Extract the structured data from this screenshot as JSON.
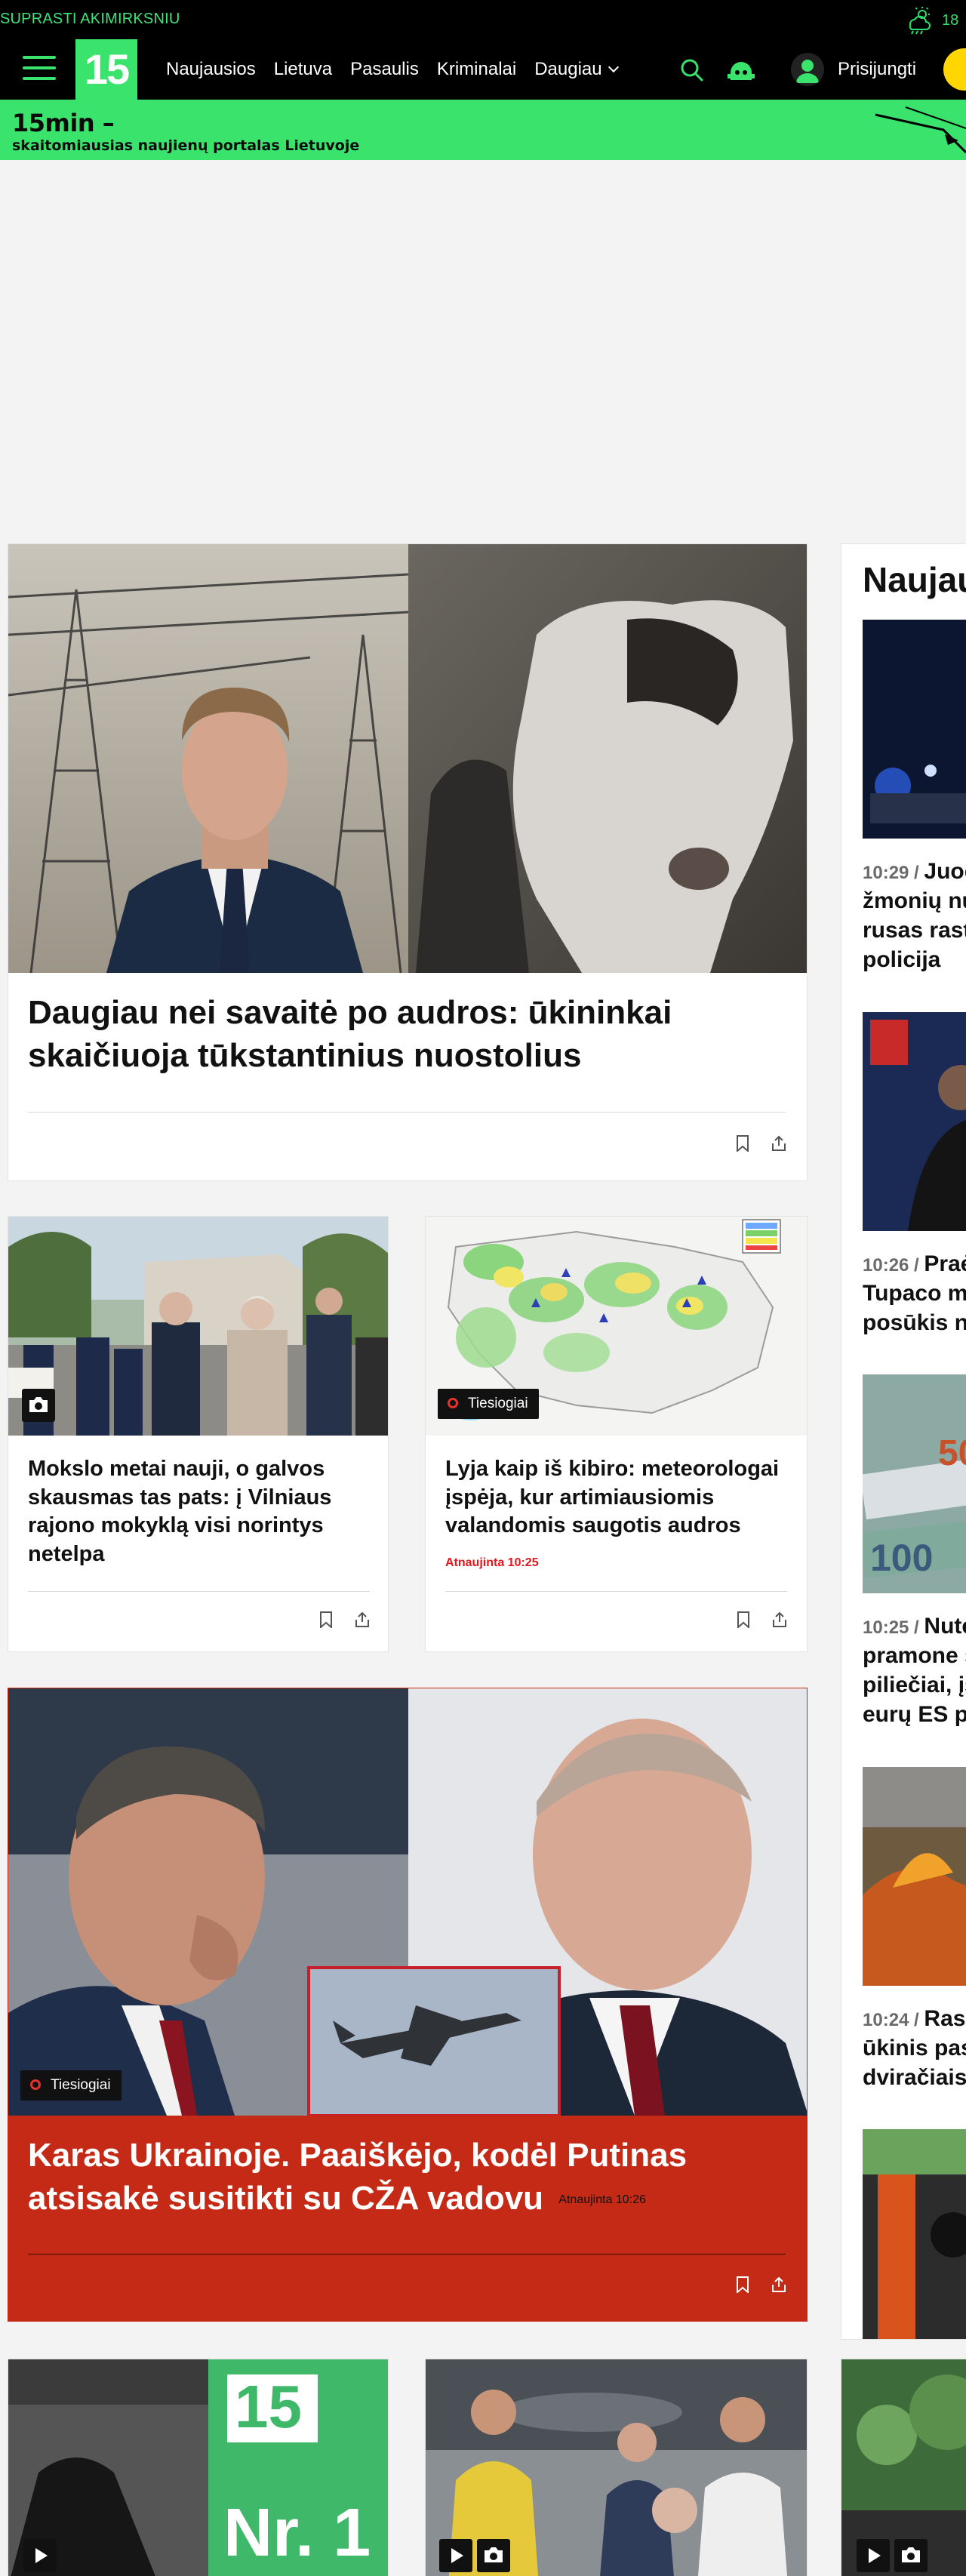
{
  "ticker": "SUPRASTI AKIMIRKSNIU",
  "weather": {
    "icon": "cloud-sun-rain-icon",
    "temperature": "18"
  },
  "nav": {
    "logo": "15",
    "menu": [
      "Naujausios",
      "Lietuva",
      "Pasaulis",
      "Kriminalai",
      "Daugiau"
    ],
    "login": "Prisijungti"
  },
  "tagline": {
    "brand": "15min –",
    "slogan": "skaitomiausias naujienų portalas Lietuvoje"
  },
  "main": {
    "hero": {
      "title": "Daugiau nei savaitė po audros: ūkininkai skaičiuoja tūkstantinius nuostolius"
    },
    "card_school": {
      "title": "Mokslo metai nauji, o galvos skausmas tas pats: į Vilniaus rajono mokyklą visi norintys netelpa"
    },
    "card_weather": {
      "badge": "Tiesiogiai",
      "title": "Lyja kaip iš kibiro: meteorologai įspėja, kur artimiausiomis valandomis saugotis audros",
      "updated": "Atnaujinta 10:25"
    },
    "war": {
      "badge": "Tiesiogiai",
      "title": "Karas Ukrainoje. Paaiškėjo, kodėl Putinas atsisakė susitikti su CŽA vadovu",
      "updated": "Atnaujinta 10:26"
    }
  },
  "sidebar": {
    "heading": "Naujausios",
    "items": [
      {
        "time": "10:29",
        "lines": [
          "Juod",
          "žmonių nu",
          "rusas rast",
          "policija"
        ]
      },
      {
        "time": "10:26",
        "lines": [
          "Praė",
          "Tupaco m",
          "posūkis nu"
        ]
      },
      {
        "time": "10:25",
        "lines": [
          "Nute",
          "pramone s",
          "piliečiai, įs",
          "eurų ES pa"
        ]
      },
      {
        "time": "10:24",
        "lines": [
          "Rase",
          "ūkinis pas",
          "dviračiais"
        ]
      }
    ]
  },
  "colors": {
    "accent": "#39e36c",
    "war_bg": "#c42a16",
    "live_ring": "#e5322d",
    "updated": "#e0171d"
  }
}
